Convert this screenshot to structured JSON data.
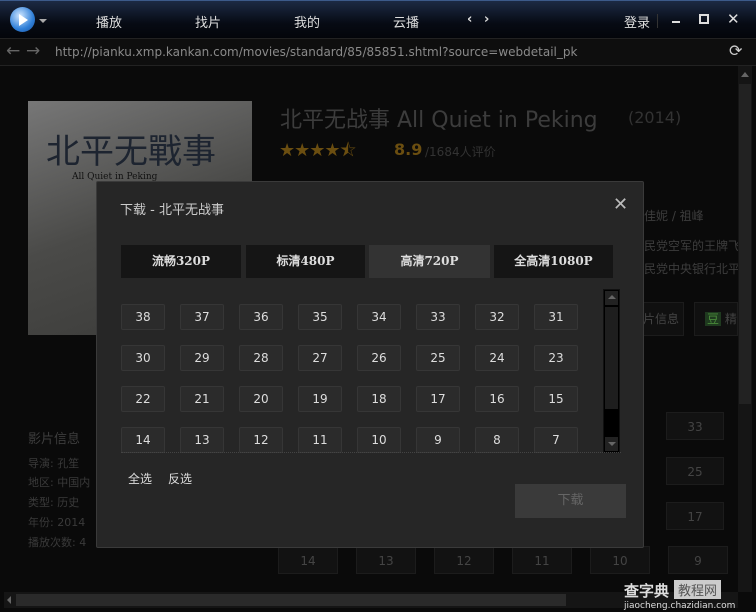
{
  "titlebar": {
    "nav": [
      "播放",
      "找片",
      "我的",
      "云播"
    ],
    "login": "登录"
  },
  "address": {
    "url": "http://pianku.xmp.kankan.com/movies/standard/85/85851.shtml?source=webdetail_pk"
  },
  "movie": {
    "title": "北平无战事 All Quiet in Peking",
    "year": "(2014)",
    "rating": "8.9",
    "rating_stars": 4.5,
    "rating_count": "/1684人评价",
    "cast_tail": "佳妮 / 祖峰",
    "desc1": "民党空军的王牌飞",
    "desc2": "民党中央银行北平",
    "tab_info": "片信息",
    "tab_douban": "精",
    "douban_icon": "豆",
    "poster_title": "北平无戰事",
    "poster_sub": "All Quiet in Peking",
    "info_heading": "影片信息",
    "info": [
      "导演: 孔笙 ",
      "地区: 中国内",
      "类型: 历史 ",
      "年份: 2014",
      "播放次数: 4"
    ],
    "bg_right_col": [
      "33",
      "25",
      "17"
    ],
    "bg_bottom_row": [
      "14",
      "13",
      "12",
      "11",
      "10",
      "9"
    ]
  },
  "dialog": {
    "title": "下载 - 北平无战事",
    "tabs": [
      "流畅320P",
      "标清480P",
      "高清720P",
      "全高清1080P"
    ],
    "active_tab": 2,
    "episodes": [
      "38",
      "37",
      "36",
      "35",
      "34",
      "33",
      "32",
      "31",
      "30",
      "29",
      "28",
      "27",
      "26",
      "25",
      "24",
      "23",
      "22",
      "21",
      "20",
      "19",
      "18",
      "17",
      "16",
      "15",
      "14",
      "13",
      "12",
      "11",
      "10",
      "9",
      "8",
      "7"
    ],
    "select_all": "全选",
    "invert": "反选",
    "download": "下载"
  },
  "watermark": {
    "brand": "查字典",
    "label": "教程网",
    "url": "jiaocheng.chazidian.com"
  }
}
